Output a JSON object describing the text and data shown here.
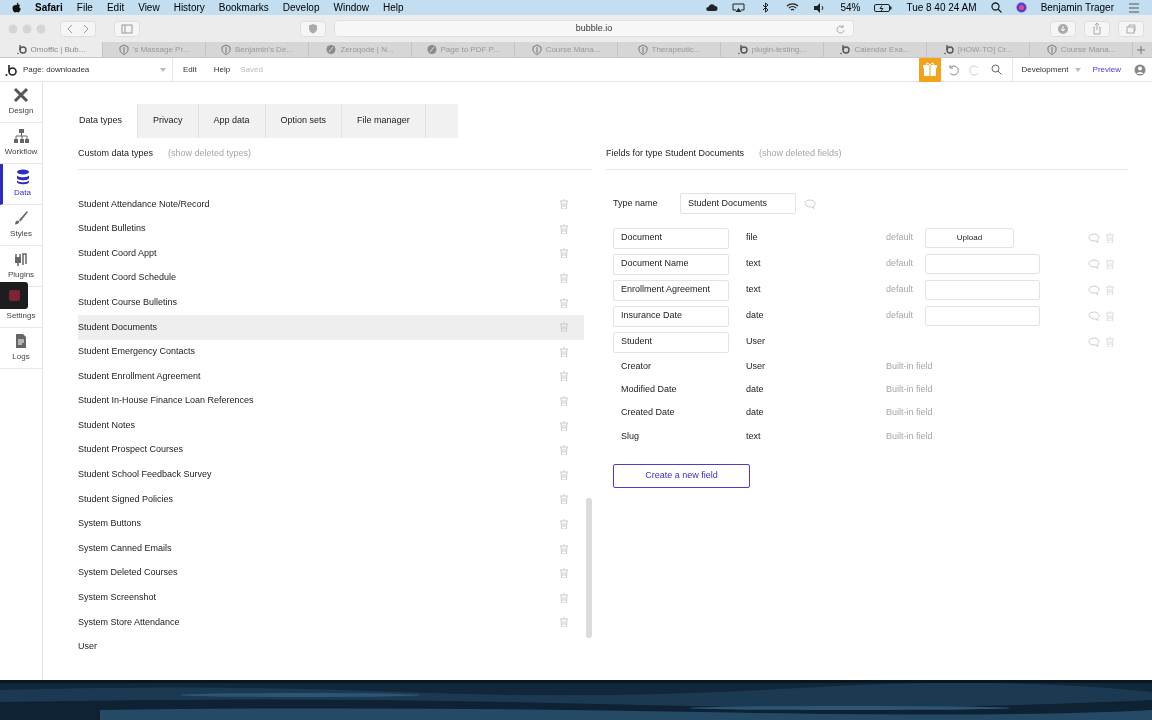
{
  "menu_bar": {
    "app": "Safari",
    "items": [
      "File",
      "Edit",
      "View",
      "History",
      "Bookmarks",
      "Develop",
      "Window",
      "Help"
    ],
    "battery": "54%",
    "clock": "Tue 8 40 24 AM",
    "user": "Benjamin Trager"
  },
  "browser": {
    "address": "bubble.io",
    "tabs": [
      {
        "label": "Omoffic | Bub...",
        "kind": "bubble",
        "selected": true
      },
      {
        "label": "'s Massage Pr...",
        "kind": "shield",
        "selected": false
      },
      {
        "label": "Benjamin's De...",
        "kind": "shield",
        "selected": false
      },
      {
        "label": "Zeroqode | N...",
        "kind": "circle",
        "selected": false
      },
      {
        "label": "Page to PDF P...",
        "kind": "circle",
        "selected": false
      },
      {
        "label": "Course Mana...",
        "kind": "shield",
        "selected": false
      },
      {
        "label": "Therapeutic...",
        "kind": "shield",
        "selected": false
      },
      {
        "label": "plugin-testing...",
        "kind": "bubble",
        "selected": false
      },
      {
        "label": "Calendar Exa...",
        "kind": "bubble",
        "selected": false
      },
      {
        "label": "[HOW-TO] Cr...",
        "kind": "bubble",
        "selected": false
      },
      {
        "label": "Course Mana...",
        "kind": "shield",
        "selected": false
      }
    ]
  },
  "editor_bar": {
    "page": "Page: downloadea",
    "edit": "Edit",
    "help": "Help",
    "status": "Saved",
    "environment": "Development",
    "preview": "Preview"
  },
  "sidebar": {
    "items": [
      {
        "label": "Design",
        "kind": "design",
        "selected": false
      },
      {
        "label": "Workflow",
        "kind": "workflow",
        "selected": false
      },
      {
        "label": "Data",
        "kind": "data",
        "selected": true
      },
      {
        "label": "Styles",
        "kind": "styles",
        "selected": false
      },
      {
        "label": "Plugins",
        "kind": "plugins",
        "selected": false
      },
      {
        "label": "Settings",
        "kind": "settings",
        "selected": false
      },
      {
        "label": "Logs",
        "kind": "logs",
        "selected": false
      }
    ]
  },
  "tabs": [
    {
      "label": "Data types",
      "selected": true
    },
    {
      "label": "Privacy",
      "selected": false
    },
    {
      "label": "App data",
      "selected": false
    },
    {
      "label": "Option sets",
      "selected": false
    },
    {
      "label": "File manager",
      "selected": false
    }
  ],
  "data_types": {
    "title": "Custom data types",
    "link": "(show deleted types)",
    "items": [
      {
        "name": "Student Attendance Note/Record",
        "selected": false,
        "deletable": true
      },
      {
        "name": "Student Bulletins",
        "selected": false,
        "deletable": true
      },
      {
        "name": "Student Coord Appt",
        "selected": false,
        "deletable": true
      },
      {
        "name": "Student Coord Schedule",
        "selected": false,
        "deletable": true
      },
      {
        "name": "Student Course Bulletins",
        "selected": false,
        "deletable": true
      },
      {
        "name": "Student Documents",
        "selected": true,
        "deletable": true
      },
      {
        "name": "Student Emergency Contacts",
        "selected": false,
        "deletable": true
      },
      {
        "name": "Student Enrollment Agreement",
        "selected": false,
        "deletable": true
      },
      {
        "name": "Student In-House Finance Loan References",
        "selected": false,
        "deletable": true
      },
      {
        "name": "Student Notes",
        "selected": false,
        "deletable": true
      },
      {
        "name": "Student Prospect Courses",
        "selected": false,
        "deletable": true
      },
      {
        "name": "Student School Feedback Survey",
        "selected": false,
        "deletable": true
      },
      {
        "name": "Student Signed Policies",
        "selected": false,
        "deletable": true
      },
      {
        "name": "System Buttons",
        "selected": false,
        "deletable": true
      },
      {
        "name": "System Canned Emails",
        "selected": false,
        "deletable": true
      },
      {
        "name": "System Deleted Courses",
        "selected": false,
        "deletable": true
      },
      {
        "name": "System Screenshot",
        "selected": false,
        "deletable": true
      },
      {
        "name": "System Store Attendance",
        "selected": false,
        "deletable": true
      },
      {
        "name": "User",
        "selected": false,
        "deletable": false
      }
    ]
  },
  "fields_panel": {
    "title": "Fields for type Student Documents",
    "link": "(show deleted fields)",
    "type_name_label": "Type name",
    "type_name": "Student Documents",
    "fields": [
      {
        "name": "Document",
        "type": "file",
        "kind": "custom",
        "default_label": "default",
        "has_default_field": false,
        "upload": "Upload"
      },
      {
        "name": "Document Name",
        "type": "text",
        "kind": "custom",
        "default_label": "default",
        "has_default_field": true
      },
      {
        "name": "Enrollment Agreement",
        "type": "text",
        "kind": "custom",
        "default_label": "default",
        "has_default_field": true
      },
      {
        "name": "Insurance Date",
        "type": "date",
        "kind": "custom",
        "default_label": "default",
        "has_default_field": true
      },
      {
        "name": "Student",
        "type": "User",
        "kind": "custom",
        "has_default_field": false
      },
      {
        "name": "Creator",
        "type": "User",
        "kind": "builtin",
        "note": "Built-in field"
      },
      {
        "name": "Modified Date",
        "type": "date",
        "kind": "builtin",
        "note": "Built-in field"
      },
      {
        "name": "Created Date",
        "type": "date",
        "kind": "builtin",
        "note": "Built-in field"
      },
      {
        "name": "Slug",
        "type": "text",
        "kind": "builtin",
        "note": "Built-in field"
      }
    ],
    "create_button": "Create a new field"
  }
}
